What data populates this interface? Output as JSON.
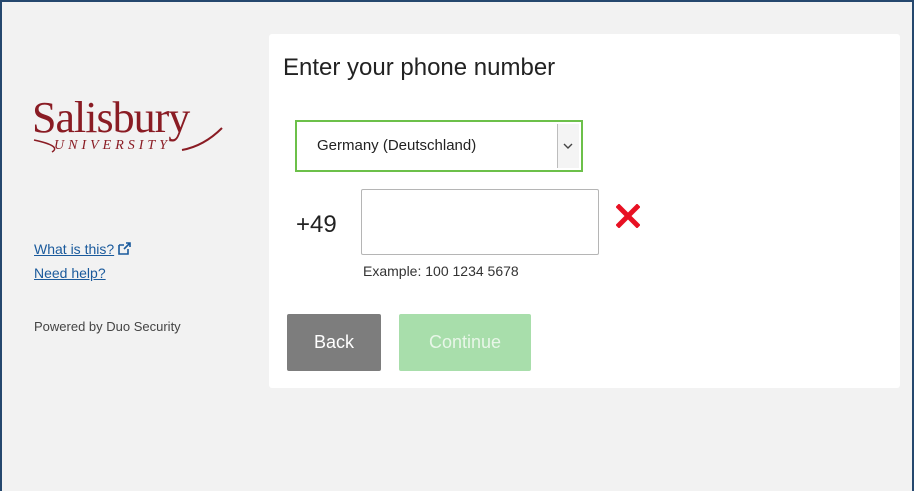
{
  "logo": {
    "wordmark": "Salisbury",
    "subtitle": "UNIVERSITY",
    "color": "#8a1c24"
  },
  "sidebar": {
    "links": [
      {
        "label": "What is this?",
        "icon": "external-link-icon"
      },
      {
        "label": "Need help?"
      }
    ],
    "powered_by": "Powered by Duo Security"
  },
  "form": {
    "title": "Enter your phone number",
    "country": {
      "selected": "Germany (Deutschland)"
    },
    "dial_prefix": "+49",
    "phone_value": "",
    "example": "Example: 100 1234 5678",
    "validation_icon": "red-x-icon",
    "buttons": {
      "back": "Back",
      "continue": "Continue"
    }
  },
  "colors": {
    "accent_green": "#6cc04a",
    "link_blue": "#1a5a9c",
    "error_red": "#e81123",
    "frame_border": "#25486e"
  }
}
